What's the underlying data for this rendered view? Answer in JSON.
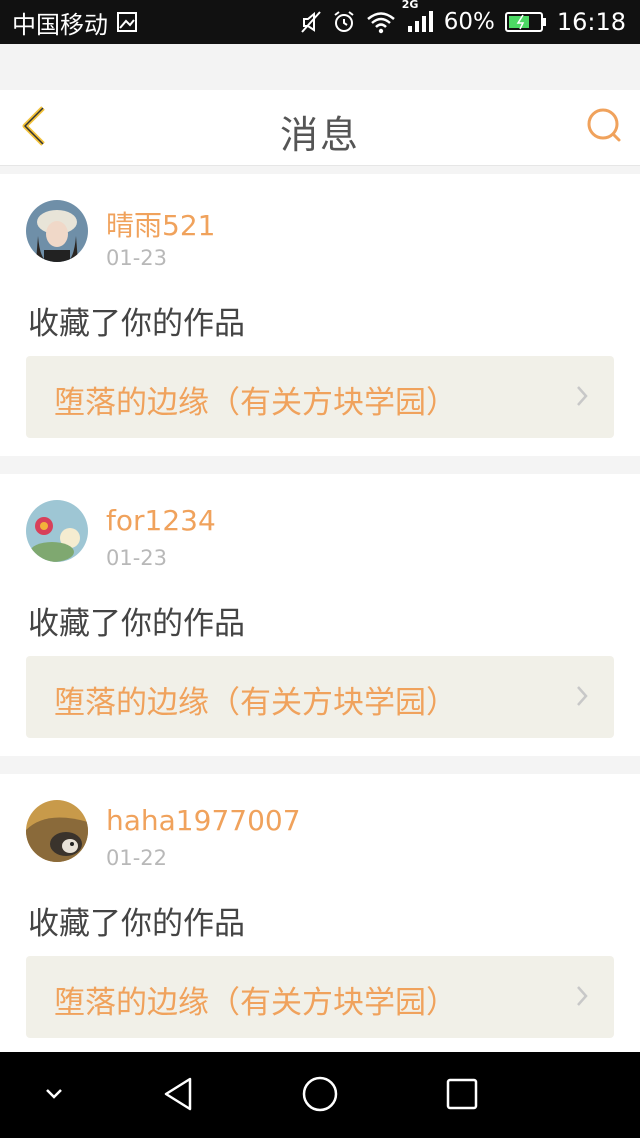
{
  "status_bar": {
    "carrier": "中国移动",
    "network_badge": "2G",
    "battery": "60%",
    "time": "16:18",
    "icons": [
      "image-icon",
      "mute-icon",
      "alarm-icon",
      "wifi-icon",
      "signal-icon",
      "battery-icon"
    ]
  },
  "header": {
    "title": "消息",
    "back_icon": "chevron-left-icon",
    "search_icon": "search-icon",
    "accent_color": "#f0a25c"
  },
  "messages": [
    {
      "user": "晴雨521",
      "date": "01-23",
      "action": "收藏了你的作品",
      "work": "堕落的边缘（有关方块学园）"
    },
    {
      "user": "for1234",
      "date": "01-23",
      "action": "收藏了你的作品",
      "work": "堕落的边缘（有关方块学园）"
    },
    {
      "user": "haha1977007",
      "date": "01-22",
      "action": "收藏了你的作品",
      "work": "堕落的边缘（有关方块学园）"
    }
  ],
  "nav_bar": {
    "icons": [
      "collapse-icon",
      "back-triangle-icon",
      "home-circle-icon",
      "recents-square-icon"
    ]
  }
}
